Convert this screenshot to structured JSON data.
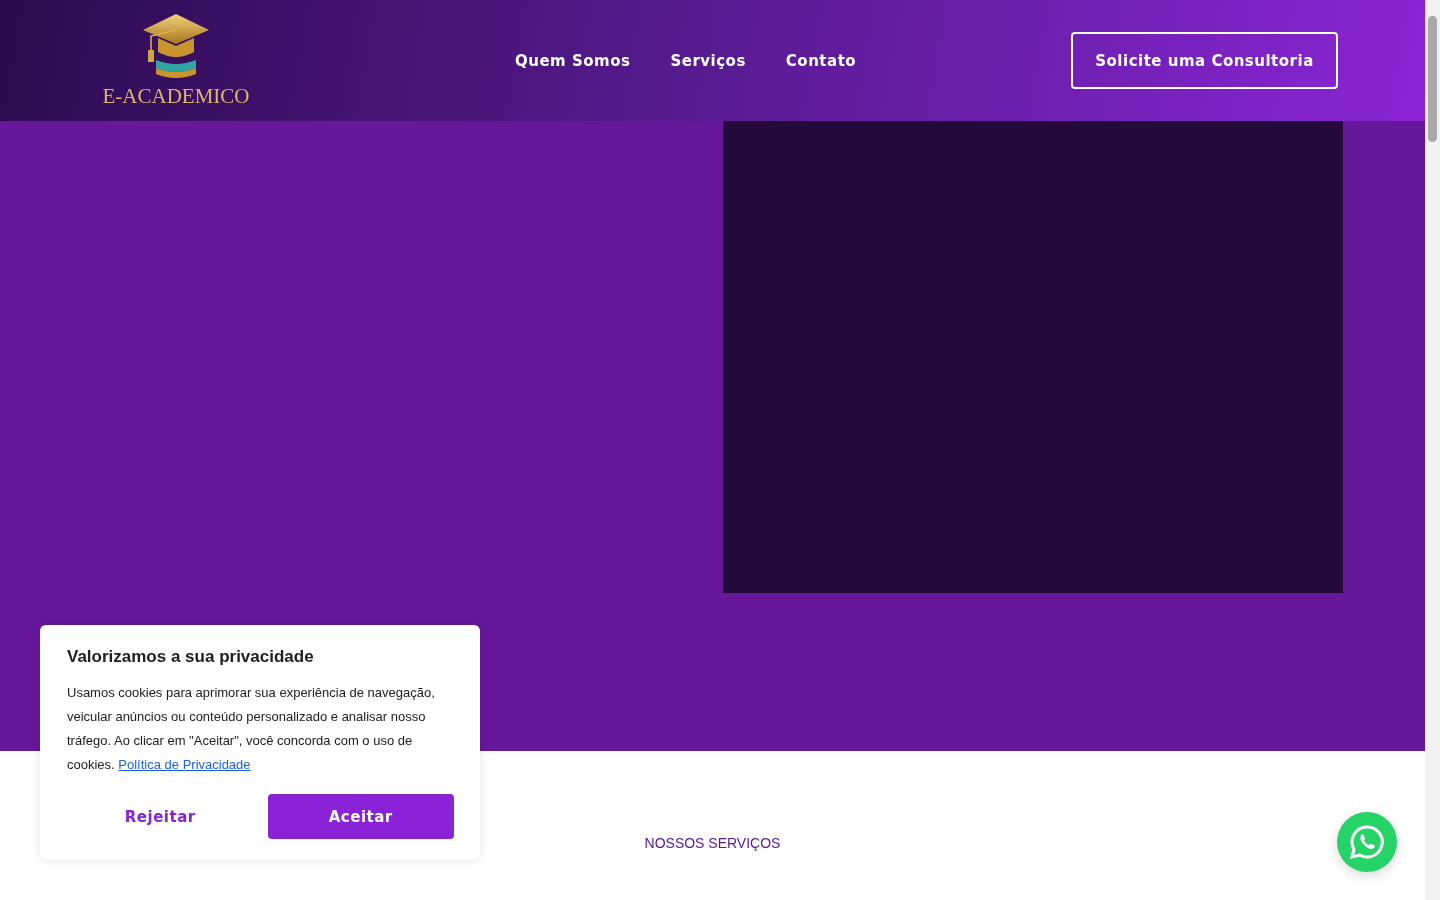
{
  "logo": {
    "text": "E-ACADEMICO"
  },
  "nav": [
    {
      "label": "Quem Somos"
    },
    {
      "label": "Serviços"
    },
    {
      "label": "Contato"
    }
  ],
  "cta": {
    "label": "Solicite uma Consultoria"
  },
  "section": {
    "eyebrow": "NOSSOS SERVIÇOS"
  },
  "cookie_banner": {
    "title": "Valorizamos a sua privacidade",
    "text": "Usamos cookies para aprimorar sua experiência de navegação, veicular anúncios ou conteúdo personalizado e analisar nosso tráfego. Ao clicar em \"Aceitar\", você concorda com o uso de cookies.",
    "link": "Política de Privacidade",
    "buttons": [
      {
        "label": "Rejeitar",
        "kind": "secondary"
      },
      {
        "label": "Aceitar",
        "kind": "primary"
      }
    ]
  }
}
